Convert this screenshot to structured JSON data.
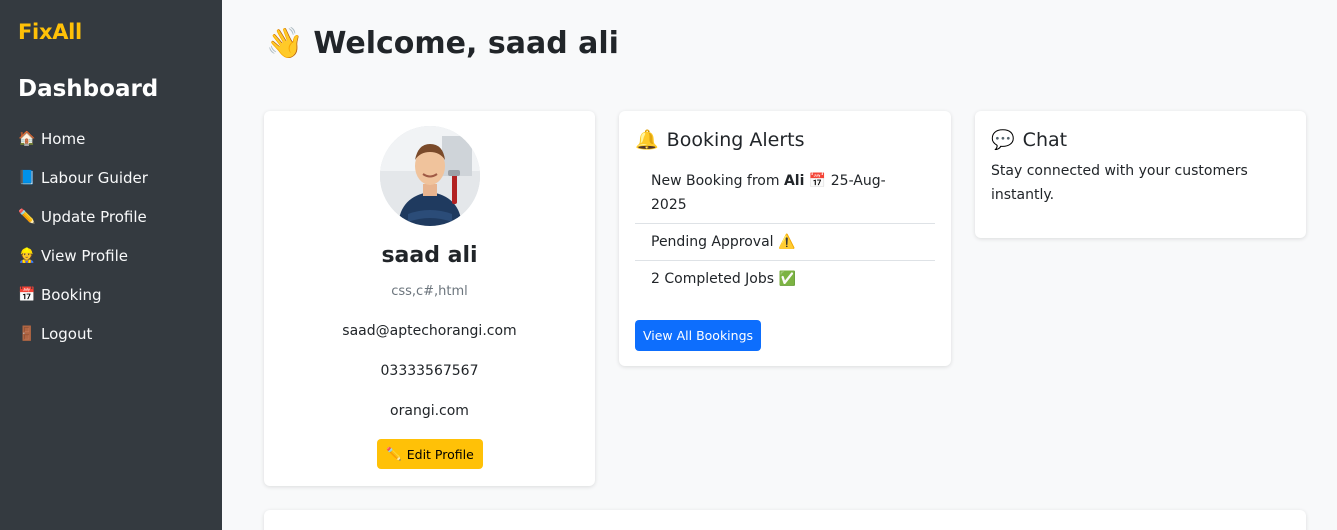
{
  "sidebar": {
    "brand": "FixAll",
    "title": "Dashboard",
    "items": [
      {
        "icon": "🏠",
        "label": "Home"
      },
      {
        "icon": "📘",
        "label": "Labour Guider"
      },
      {
        "icon": "✏️",
        "label": "Update Profile"
      },
      {
        "icon": "👷",
        "label": "View Profile"
      },
      {
        "icon": "📅",
        "label": "Booking"
      },
      {
        "icon": "🚪",
        "label": "Logout"
      }
    ]
  },
  "header": {
    "wave_icon": "👋",
    "welcome": "Welcome, saad ali"
  },
  "profile": {
    "name": "saad ali",
    "skills": "css,c#,html",
    "email": "saad@aptechorangi.com",
    "phone": "03333567567",
    "website": "orangi.com",
    "edit_icon": "✏️",
    "edit_label": "Edit Profile"
  },
  "alerts": {
    "icon": "🔔",
    "title": "Booking Alerts",
    "new_booking_prefix": "New Booking from",
    "new_booking_name": "Ali",
    "calendar_icon": "📅",
    "new_booking_date": "25-Aug-2025",
    "pending": "Pending Approval",
    "pending_icon": "⚠️",
    "completed": "2 Completed Jobs",
    "completed_icon": "✅",
    "view_all": "View All Bookings"
  },
  "chat": {
    "icon": "💬",
    "title": "Chat",
    "text": "Stay connected with your customers instantly."
  },
  "colors": {
    "sidebar_bg": "#343a40",
    "brand": "#ffc107",
    "primary": "#0d6efd",
    "warning": "#ffc107"
  }
}
